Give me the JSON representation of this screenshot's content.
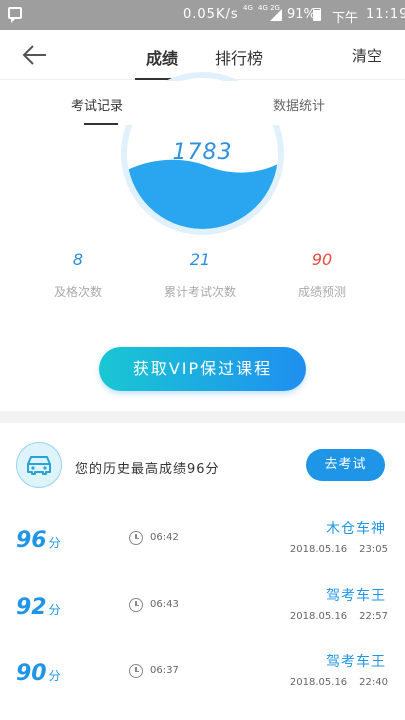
{
  "status_bar": {
    "speed": "0.05K/s",
    "network_top": "4G",
    "network_bottom": "4G 2G",
    "battery_pct": "91%",
    "ampm": "下午",
    "time": "11:19"
  },
  "nav": {
    "tab_score": "成绩",
    "tab_rank": "排行榜",
    "clear": "清空"
  },
  "subtabs": {
    "records": "考试记录",
    "stats": "数据统计"
  },
  "gauge": {
    "value": "1783",
    "wave_color": "#2aa6f0"
  },
  "stats": {
    "pass_count": "8",
    "pass_label": "及格次数",
    "total_count": "21",
    "total_label": "累计考试次数",
    "prediction": "90",
    "prediction_label": "成绩预测"
  },
  "vip_button": "获取VIP保过课程",
  "best": {
    "text": "您的历史最高成绩96分",
    "exam_button": "去考试"
  },
  "records": [
    {
      "score": "96",
      "unit": "分",
      "duration": "06:42",
      "title": "木仓车神",
      "date": "2018.05.16",
      "time": "23:05"
    },
    {
      "score": "92",
      "unit": "分",
      "duration": "06:43",
      "title": "驾考车王",
      "date": "2018.05.16",
      "time": "22:57"
    },
    {
      "score": "90",
      "unit": "分",
      "duration": "06:37",
      "title": "驾考车王",
      "date": "2018.05.16",
      "time": "22:40"
    }
  ],
  "colors": {
    "accent": "#1f95e8",
    "danger": "#e74c3c",
    "status_bar": "#9e9e9e"
  }
}
